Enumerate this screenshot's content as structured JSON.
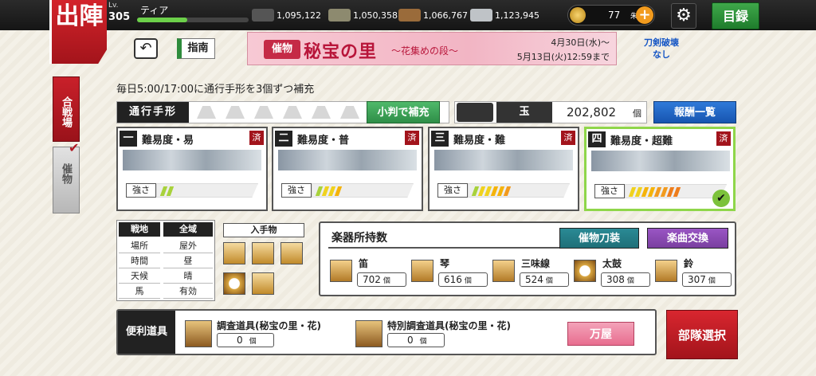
{
  "header": {
    "title": "出陣",
    "level_label": "Lv.",
    "level": "305",
    "player_name": "ティア",
    "exp_progress": 0.45,
    "resources": [
      {
        "name": "charcoal-icon",
        "value": "1,095,122"
      },
      {
        "name": "tamahagane-icon",
        "value": "1,050,358"
      },
      {
        "name": "cooling-material-icon",
        "value": "1,066,767"
      },
      {
        "name": "whetstone-icon",
        "value": "1,123,945"
      }
    ],
    "koban_value": "77",
    "koban_unit": "朱",
    "menu_label": "目録"
  },
  "toolbar": {
    "guide_label": "指南"
  },
  "banner": {
    "tag": "催物",
    "title": "秘宝の里",
    "subtitle": "〜花集めの段〜",
    "date_start": "4月30日(水)〜",
    "date_end": "5月13日(火)12:59まで"
  },
  "no_sword_break": {
    "line1": "刀剣破壊",
    "line2": "なし"
  },
  "side_tabs": {
    "kassenba": "合戦場",
    "saimotsu": "催物"
  },
  "notice": "毎日5:00/17:00に通行手形を3個ずつ補充",
  "pass": {
    "label": "通行手形",
    "count_icons": 6,
    "refill_button": "小判で補充"
  },
  "tama": {
    "label": "玉",
    "value": "202,802",
    "unit": "個"
  },
  "reward_button": "報酬一覧",
  "difficulties": [
    {
      "num": "一",
      "name": "難易度・易",
      "done": "済",
      "strength_label": "強さ",
      "level": 2
    },
    {
      "num": "二",
      "name": "難易度・普",
      "done": "済",
      "strength_label": "強さ",
      "level": 4
    },
    {
      "num": "三",
      "name": "難易度・難",
      "done": "済",
      "strength_label": "強さ",
      "level": 6
    },
    {
      "num": "四",
      "name": "難易度・超難",
      "done": "済",
      "strength_label": "強さ",
      "level": 8,
      "selected": true
    }
  ],
  "conditions": {
    "headers": [
      "戦地",
      "全域"
    ],
    "rows": [
      {
        "key": "場所",
        "value": "屋外"
      },
      {
        "key": "時間",
        "value": "昼"
      },
      {
        "key": "天候",
        "value": "晴"
      },
      {
        "key": "馬",
        "value": "有効"
      }
    ]
  },
  "acquired": {
    "label": "入手物"
  },
  "instruments": {
    "title": "楽器所持数",
    "event_sword_button": "催物刀装",
    "music_exchange_button": "楽曲交換",
    "items": [
      {
        "name": "笛",
        "count": "702",
        "unit": "個"
      },
      {
        "name": "琴",
        "count": "616",
        "unit": "個"
      },
      {
        "name": "三味線",
        "count": "524",
        "unit": "個"
      },
      {
        "name": "太鼓",
        "count": "308",
        "unit": "個"
      },
      {
        "name": "鈴",
        "count": "307",
        "unit": "個"
      }
    ]
  },
  "tools": {
    "label": "便利道具",
    "items": [
      {
        "name": "調査道具(秘宝の里・花)",
        "count": "0",
        "unit": "個"
      },
      {
        "name": "特別調査道具(秘宝の里・花)",
        "count": "0",
        "unit": "個"
      }
    ]
  },
  "yorozuya": "万屋",
  "squad_button": "部隊選択",
  "colors": {
    "accent_red": "#c9202a",
    "green": "#2f8e48",
    "blue": "#1755b0",
    "purple": "#7a3fa0",
    "teal": "#1f6f78"
  }
}
